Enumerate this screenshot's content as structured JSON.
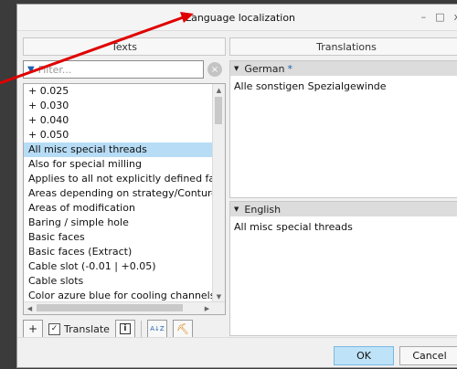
{
  "window": {
    "title": "Language localization",
    "min_glyph": "–",
    "restore_glyph": "□",
    "close_glyph": "x"
  },
  "texts_panel": {
    "header": "Texts",
    "filter_placeholder": "Filter...",
    "clear_glyph": "⊗",
    "items": [
      "+ 0.025",
      "+ 0.030",
      "+ 0.040",
      "+ 0.050",
      "All misc special threads",
      "Also for special milling",
      "Applies to all not explicitly defined faces",
      "Areas depending on strategy/Contur-mode",
      "Areas of modification",
      "Baring / simple hole",
      "Basic faces",
      "Basic faces (Extract)",
      "Cable slot (-0.01 | +0.05)",
      "Cable slots",
      "Color azure blue for cooling channels"
    ],
    "selected_index": 4,
    "toolbar": {
      "add_glyph": "+",
      "translate_label": "Translate",
      "translate_checked": "✓",
      "info_glyph": "i",
      "sort_glyph": "A↓Z",
      "clean_glyph": "⛏"
    }
  },
  "translations_panel": {
    "header": "Translations",
    "languages": [
      {
        "name": "German",
        "marker": "*",
        "text": "Alle sonstigen Spezialgewinde"
      },
      {
        "name": "English",
        "marker": "",
        "text": "All misc special threads"
      }
    ]
  },
  "footer": {
    "ok_label": "OK",
    "cancel_label": "Cancel"
  },
  "colors": {
    "selection": "#b7dcf5",
    "accent": "#1e5fb0",
    "arrow": "#e00000"
  }
}
